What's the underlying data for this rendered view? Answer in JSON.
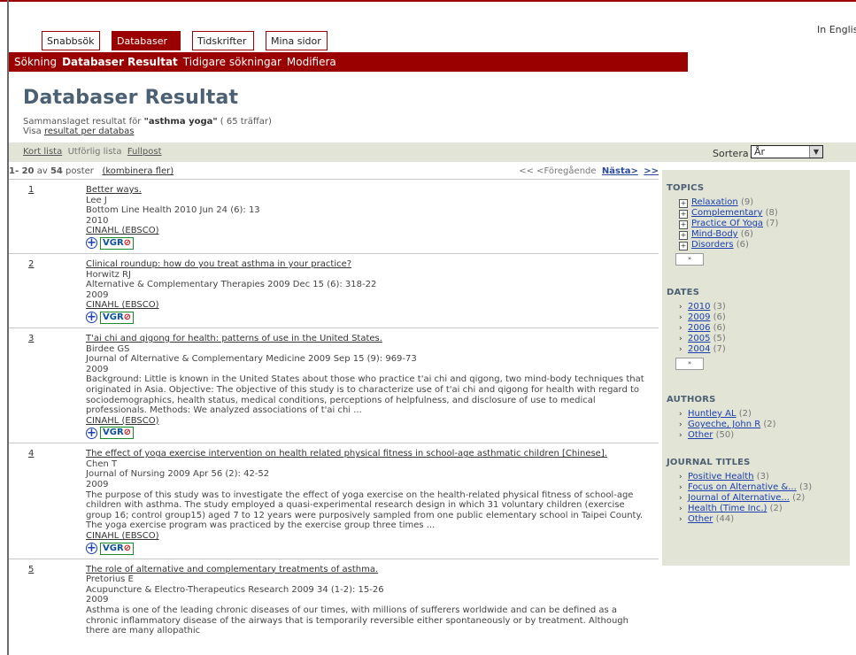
{
  "lang_link": "In English",
  "tabs": [
    {
      "label": "Snabbsök",
      "active": false
    },
    {
      "label": "Databaser",
      "active": true
    },
    {
      "label": "Tidskrifter",
      "active": false
    },
    {
      "label": "Mina sidor",
      "active": false
    }
  ],
  "subnav": {
    "item1": "Sökning",
    "item2": "Databaser Resultat",
    "item3": "Tidigare sökningar",
    "item4": "Modifiera"
  },
  "page_title": "Databaser Resultat",
  "summary": {
    "prefix": "Sammanslaget resultat för",
    "query": "\"asthma yoga\"",
    "hits": "( 65 träffar)",
    "visa": "Visa",
    "per_db_link": "resultat per databas"
  },
  "view_options": {
    "short": "Kort lista",
    "detailed": "Utförlig lista",
    "full": "Fullpost"
  },
  "sort": {
    "label": "Sortera på:",
    "value": "År"
  },
  "paging": {
    "range": "1- 20",
    "of": "av",
    "total": "54",
    "posts": "poster",
    "combine": "(kombinera fler)",
    "prev": "<< <Föregående",
    "next": "Nästa>",
    "last": ">>"
  },
  "records": [
    {
      "num": "1",
      "title": "Better ways.",
      "author": "Lee J",
      "journal": "Bottom Line Health 2010 Jun 24 (6): 13",
      "year": "2010",
      "abstract": "",
      "source": "CINAHL (EBSCO)"
    },
    {
      "num": "2",
      "title": "Clinical roundup: how do you treat asthma in your practice?",
      "author": "Horwitz RJ",
      "journal": "Alternative & Complementary Therapies 2009 Dec 15 (6): 318-22",
      "year": "2009",
      "abstract": "",
      "source": "CINAHL (EBSCO)"
    },
    {
      "num": "3",
      "title": "T'ai chi and qigong for health: patterns of use in the United States.",
      "author": "Birdee GS",
      "journal": "Journal of Alternative & Complementary Medicine 2009 Sep 15 (9): 969-73",
      "year": "2009",
      "abstract": "Background: Little is known in the United States about those who practice t'ai chi and qigong, two mind-body techniques that originated in Asia. Objective: The objective of this study is to characterize use of t'ai chi and qigong for health with regard to sociodemographics, health status, medical conditions, perceptions of helpfulness, and disclosure of use to medical professionals. Methods: We analyzed associations of t'ai chi ...",
      "source": "CINAHL (EBSCO)"
    },
    {
      "num": "4",
      "title": "The effect of yoga exercise intervention on health related physical fitness in school-age asthmatic children [Chinese].",
      "author": "Chen T",
      "journal": "Journal of Nursing 2009 Apr 56 (2): 42-52",
      "year": "2009",
      "abstract": "The purpose of this study was to investigate the effect of yoga exercise on the health-related physical fitness of school-age children with asthma. The study employed a quasi-experimental research design in which 31 voluntary children (exercise group 16; control group15) aged 7 to 12 years were purposively sampled from one public elementary school in Taipei County. The yoga exercise program was practiced by the exercise group three times ...",
      "source": "CINAHL (EBSCO)"
    },
    {
      "num": "5",
      "title": "The role of alternative and complementary treatments of asthma.",
      "author": "Pretorius E",
      "journal": "Acupuncture & Electro-Therapeutics Research 2009 34 (1-2): 15-26",
      "year": "2009",
      "abstract": "Asthma is one of the leading chronic diseases of our times, with millions of sufferers worldwide and can be defined as a chronic inflammatory disease of the airways that is temporarily reversible either spontaneously or by treatment. Although there are many allopathic",
      "source": ""
    }
  ],
  "badge": {
    "vgr": "VGR",
    "symbol": "⊘"
  },
  "sidebar": {
    "topics": {
      "head": "TOPICS",
      "items": [
        {
          "label": "Relaxation",
          "count": "(9)"
        },
        {
          "label": "Complementary",
          "count": "(8)"
        },
        {
          "label": "Practice Of Yoga",
          "count": "(7)"
        },
        {
          "label": "Mind-Body",
          "count": "(6)"
        },
        {
          "label": "Disorders",
          "count": "(6)"
        }
      ]
    },
    "dates": {
      "head": "DATES",
      "items": [
        {
          "label": "2010",
          "count": "(3)"
        },
        {
          "label": "2009",
          "count": "(6)"
        },
        {
          "label": "2006",
          "count": "(6)"
        },
        {
          "label": "2005",
          "count": "(5)"
        },
        {
          "label": "2004",
          "count": "(7)"
        }
      ]
    },
    "authors": {
      "head": "AUTHORS",
      "items": [
        {
          "label": "Huntley AL",
          "count": "(2)"
        },
        {
          "label": "Goyeche, John R",
          "count": "(2)"
        },
        {
          "label": "Other",
          "count": "(50)"
        }
      ]
    },
    "journals": {
      "head": "JOURNAL TITLES",
      "items": [
        {
          "label": "Positive Health",
          "count": "(3)"
        },
        {
          "label": "Focus on Alternative &...",
          "count": "(3)"
        },
        {
          "label": "Journal of Alternative...",
          "count": "(2)"
        },
        {
          "label": "Health (Time Inc.)",
          "count": "(2)"
        },
        {
          "label": "Other",
          "count": "(44)"
        }
      ]
    },
    "more_symbol": "»"
  }
}
